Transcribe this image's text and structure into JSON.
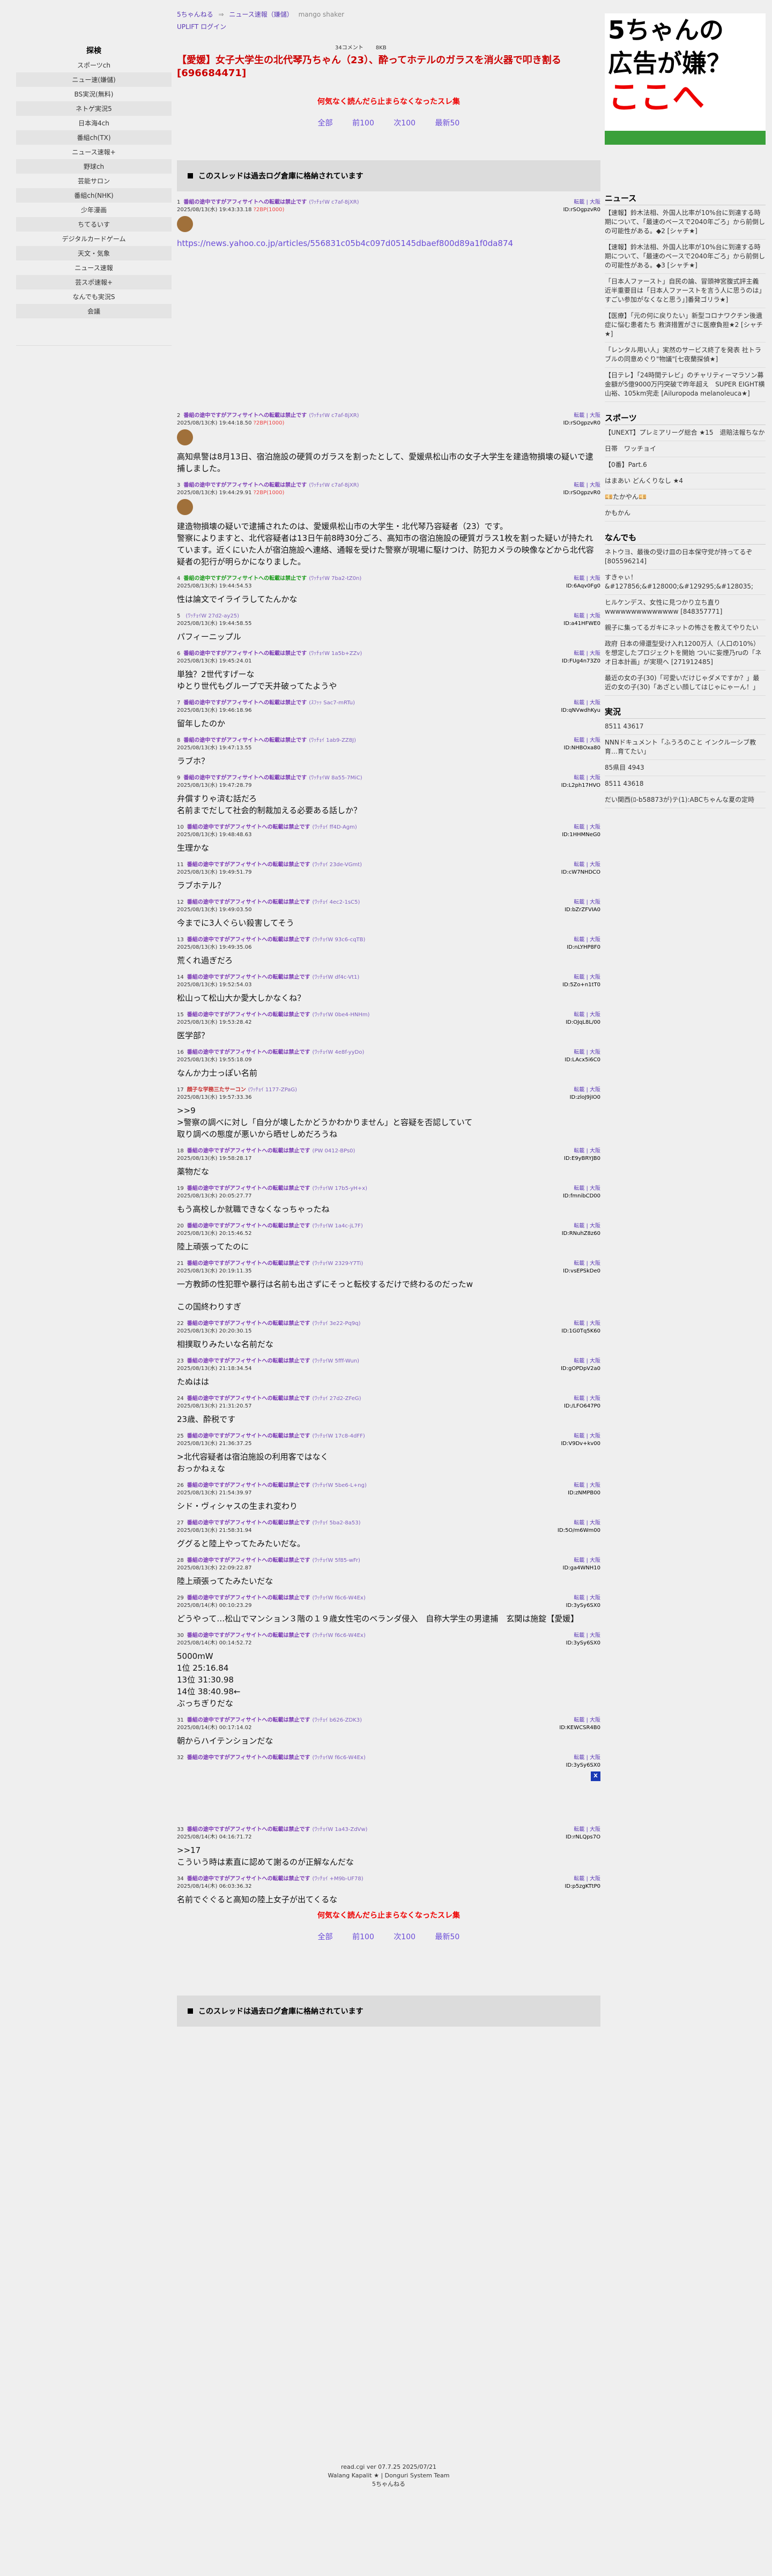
{
  "left": {
    "head": "探検",
    "items": [
      "スポーツch",
      "ニュー速(嫌儲)",
      "BS実況(無料)",
      "ネトゲ実況5",
      "日本海4ch",
      "番組ch(TX)",
      "ニュース速報+",
      "野球ch",
      "芸能サロン",
      "番組ch(NHK)",
      "少年漫画",
      "ちてるいす",
      "デジタルカードゲーム",
      "天文・気象",
      "ニュース速報",
      "芸スポ速報+",
      "なんでも実況S",
      "会議"
    ]
  },
  "nav": {
    "site": "5ちゃんねる",
    "arrow": "⇒",
    "board": "ニュース速報（嫌儲）",
    "mgm": "mango shaker",
    "login": "UPLIFT ログイン",
    "c1": "34コメント",
    "c2": "8KB"
  },
  "title": "【愛媛】女子大学生の北代琴乃ちゃん（23）、酔ってホテルのガラスを消火器で叩き割る[696684471]",
  "warn": "何気なく読んだら止まらなくなったスレ集",
  "pager": {
    "all": "全部",
    "prev": "前100",
    "next": "次100",
    "last": "最新50"
  },
  "archive": "このスレッドは過去ログ倉庫に格納されています",
  "posts": [
    {
      "n": "1",
      "nm": "番組の途中ですがアフィサイトへの転載は禁止です",
      "trip": "(ﾜｯﾁｮｲW c7af-8jXR)",
      "date": "2025/08/13(水) 19:43:33.18",
      "extra": "?2BP(1000)",
      "ref": "転載 | 大阪",
      "id": "ID:rSOgpzvR0",
      "body": [
        "https://news.yahoo.co.jp/articles/556831c05b4c097d05145dbaef800d89a1f0da874"
      ],
      "be": true,
      "link": true,
      "pad": "big"
    },
    {
      "n": "2",
      "nm": "番組の途中ですがアフィサイトへの転載は禁止です",
      "trip": "(ﾜｯﾁｮｲW c7af-8jXR)",
      "date": "2025/08/13(水) 19:44:18.50",
      "extra": "?2BP(1000)",
      "ref": "転載 | 大阪",
      "id": "ID:rSOgpzvR0",
      "body": [
        "高知県警は8月13日、宿泊施設の硬質のガラスを割ったとして、愛媛県松山市の女子大学生を建造物損壊の疑いで逮捕しました。"
      ],
      "be": true
    },
    {
      "n": "3",
      "nm": "番組の途中ですがアフィサイトへの転載は禁止です",
      "trip": "(ﾜｯﾁｮｲW c7af-8jXR)",
      "date": "2025/08/13(水) 19:44:29.91",
      "extra": "?2BP(1000)",
      "ref": "転載 | 大阪",
      "id": "ID:rSOgpzvR0",
      "body": [
        "建造物損壊の疑いで逮捕されたのは、愛媛県松山市の大学生・北代琴乃容疑者（23）です。",
        "警察によりますと、北代容疑者は13日午前8時30分ごろ、高知市の宿泊施設の硬質ガラス1枚を割った疑いが持たれています。近くにいた人が宿泊施設へ連絡、通報を受けた警察が現場に駆けつけ、防犯カメラの映像などから北代容疑者の犯行が明らかになりました。"
      ],
      "be": true
    },
    {
      "n": "4",
      "nm": "番組の途中ですがアフィサイトへの転載は禁止です",
      "trip": "(ﾜｯﾁｮｲW 7ba2-tZ0n)",
      "date": "2025/08/13(水) 19:44:54.53",
      "ref": "転載 | 大阪",
      "id": "ID:6Aqv0Fg0",
      "body": [
        "性は論文でイライラしてたんかな"
      ],
      "c": "g"
    },
    {
      "n": "5",
      "nm": "",
      "trip": "(ﾜｯﾁｮｲW 27d2-ay25)",
      "date": "2025/08/13(水) 19:44:58.55",
      "ref": "転載 | 大阪",
      "id": "ID:a41HFWE0",
      "body": [
        "パフィーニップル"
      ]
    },
    {
      "n": "6",
      "nm": "番組の途中ですがアフィサイトへの転載は禁止です",
      "trip": "(ﾜｯﾁｮｲW 1a5b+ZZv)",
      "date": "2025/08/13(水) 19:45:24.01",
      "ref": "転載 | 大阪",
      "id": "ID:FUg4n73Z0",
      "body": [
        "単独？2世代すげーな",
        "ゆとり世代もグループで天井破ってたようや"
      ]
    },
    {
      "n": "7",
      "nm": "番組の途中ですがアフィサイトへの転載は禁止です",
      "trip": "(ｽﾌｯｯ Sac7-mRTu)",
      "date": "2025/08/13(水) 19:46:18.96",
      "ref": "転載 | 大阪",
      "id": "ID:qNVwdhKyu",
      "body": [
        "留年したのか"
      ]
    },
    {
      "n": "8",
      "nm": "番組の途中ですがアフィサイトへの転載は禁止です",
      "trip": "(ﾜｯﾁｮｲ 1ab9-ZZ8J)",
      "date": "2025/08/13(水) 19:47:13.55",
      "ref": "転載 | 大阪",
      "id": "ID:NHBOxa80",
      "body": [
        "ラブホ？"
      ]
    },
    {
      "n": "9",
      "nm": "番組の途中ですがアフィサイトへの転載は禁止です",
      "trip": "(ﾜｯﾁｮｲW 8a55-7MiC)",
      "date": "2025/08/13(水) 19:47:28.79",
      "ref": "転載 | 大阪",
      "id": "ID:L2ph17HVO",
      "body": [
        "弁償すりゃ済む話だろ",
        "名前までだして社会的制裁加える必要ある話しか？"
      ]
    },
    {
      "n": "10",
      "nm": "番組の途中ですがアフィサイトへの転載は禁止です",
      "trip": "(ﾜｯﾁｮｲ ff4D-Agm)",
      "date": "2025/08/13(水) 19:48:48.63",
      "ref": "転載 | 大阪",
      "id": "ID:1HHMNeG0",
      "body": [
        "生理かな"
      ]
    },
    {
      "n": "11",
      "nm": "番組の途中ですがアフィサイトへの転載は禁止です",
      "trip": "(ﾜｯﾁｮｲ 23de-VGmt)",
      "date": "2025/08/13(水) 19:49:51.79",
      "ref": "転載 | 大阪",
      "id": "ID:cW7NHDCO",
      "body": [
        "ラブホテル？"
      ]
    },
    {
      "n": "12",
      "nm": "番組の途中ですがアフィサイトへの転載は禁止です",
      "trip": "(ﾜｯﾁｮｲ 4ec2-1sC5)",
      "date": "2025/08/13(水) 19:49:03.50",
      "ref": "転載 | 大阪",
      "id": "ID:bZrZFVIA0",
      "body": [
        "今までに3人ぐらい殺害してそう"
      ]
    },
    {
      "n": "13",
      "nm": "番組の途中ですがアフィサイトへの転載は禁止です",
      "trip": "(ﾜｯﾁｮｲW 93c6-cqTB)",
      "date": "2025/08/13(水) 19:49:35.06",
      "ref": "転載 | 大阪",
      "id": "ID:nLYHP8F0",
      "body": [
        "荒くれ過ぎだろ"
      ]
    },
    {
      "n": "14",
      "nm": "番組の途中ですがアフィサイトへの転載は禁止です",
      "trip": "(ﾜｯﾁｮｲW df4c-Vt1)",
      "date": "2025/08/13(水) 19:52:54.03",
      "ref": "転載 | 大阪",
      "id": "ID:5Zo+n1tT0",
      "body": [
        "松山って松山大か愛大しかなくね？"
      ]
    },
    {
      "n": "15",
      "nm": "番組の途中ですがアフィサイトへの転載は禁止です",
      "trip": "(ﾜｯﾁｮｲW 0be4-HNHm)",
      "date": "2025/08/13(水) 19:53:28.42",
      "ref": "転載 | 大阪",
      "id": "ID:OJqL8L/00",
      "body": [
        "医学部？"
      ]
    },
    {
      "n": "16",
      "nm": "番組の途中ですがアフィサイトへの転載は禁止です",
      "trip": "(ﾜｯﾁｮｲW 4e8f-yyDo)",
      "date": "2025/08/13(水) 19:55:18.09",
      "ref": "転載 | 大阪",
      "id": "ID:LAcx5i6C0",
      "body": [
        "なんか力士っぽい名前"
      ]
    },
    {
      "n": "17",
      "nm": "顔子な学務三たサーコン",
      "trip": "(ﾜｯﾁｮｲ 1177-ZPaG)",
      "date": "2025/08/13(水) 19:57:33.36",
      "ref": "転載 | 大阪",
      "id": "ID:zloJ9jIO0",
      "body": [
        ">>9",
        ">警察の調べに対し「自分が壊したかどうかわかりません」と容疑を否認していて",
        "取り調べの態度が悪いから晒せしめだろうね"
      ],
      "c": "r"
    },
    {
      "n": "18",
      "nm": "番組の途中ですがアフィサイトへの転載は禁止です",
      "trip": "(PW 0412-BPs0)",
      "date": "2025/08/13(水) 19:58:28.17",
      "ref": "転載 | 大阪",
      "id": "ID:E9yBRYJB0",
      "body": [
        "薬物だな"
      ]
    },
    {
      "n": "19",
      "nm": "番組の途中ですがアフィサイトへの転載は禁止です",
      "trip": "(ﾜｯﾁｮｲW 17b5-yH+x)",
      "date": "2025/08/13(水) 20:05:27.77",
      "ref": "転載 | 大阪",
      "id": "ID:fmnibCD00",
      "body": [
        "もう高校しか就職できなくなっちゃったね"
      ]
    },
    {
      "n": "20",
      "nm": "番組の途中ですがアフィサイトへの転載は禁止です",
      "trip": "(ﾜｯﾁｮｲW 1a4c-jL7F)",
      "date": "2025/08/13(水) 20:15:46.52",
      "ref": "転載 | 大阪",
      "id": "ID:RNuhZ8z60",
      "body": [
        "陸上頑張ってたのに"
      ]
    },
    {
      "n": "21",
      "nm": "番組の途中ですがアフィサイトへの転載は禁止です",
      "trip": "(ﾜｯﾁｮｲW 2329-Y7Ti)",
      "date": "2025/08/13(水) 20:19:11.35",
      "ref": "転載 | 大阪",
      "id": "ID:vsEPSkDe0",
      "body": [
        "一方教師の性犯罪や暴行は名前も出さずにそっと転校するだけで終わるのだったw",
        "",
        "この国終わりすぎ"
      ]
    },
    {
      "n": "22",
      "nm": "番組の途中ですがアフィサイトへの転載は禁止です",
      "trip": "(ﾜｯﾁｮｲ 3e22-Pq9q)",
      "date": "2025/08/13(水) 20:20:30.15",
      "ref": "転載 | 大阪",
      "id": "ID:1G0Tq5K60",
      "body": [
        "相撲取りみたいな名前だな"
      ]
    },
    {
      "n": "23",
      "nm": "番組の途中ですがアフィサイトへの転載は禁止です",
      "trip": "(ﾜｯﾁｮｲW 5fff-Wun)",
      "date": "2025/08/13(水) 21:18:34.54",
      "ref": "転載 | 大阪",
      "id": "ID:gOPDpV2a0",
      "body": [
        "たぬはは"
      ]
    },
    {
      "n": "24",
      "nm": "番組の途中ですがアフィサイトへの転載は禁止です",
      "trip": "(ﾜｯﾁｮｲ 27d2-ZFeG)",
      "date": "2025/08/13(水) 21:31:20.57",
      "ref": "転載 | 大阪",
      "id": "ID:/LFO647P0",
      "body": [
        "23歳、酔税です"
      ]
    },
    {
      "n": "25",
      "nm": "番組の途中ですがアフィサイトへの転載は禁止です",
      "trip": "(ﾜｯﾁｮｲW 17c8-4dFF)",
      "date": "2025/08/13(水) 21:36:37.25",
      "ref": "転載 | 大阪",
      "id": "ID:V9Dv+kv00",
      "body": [
        ">北代容疑者は宿泊施設の利用客ではなく",
        "おっかねぇな"
      ]
    },
    {
      "n": "26",
      "nm": "番組の途中ですがアフィサイトへの転載は禁止です",
      "trip": "(ﾜｯﾁｮｲW 5be6-L+ng)",
      "date": "2025/08/13(水) 21:54:39.97",
      "ref": "転載 | 大阪",
      "id": "ID:zNMPB00",
      "body": [
        "シド・ヴィシャスの生まれ変わり"
      ]
    },
    {
      "n": "27",
      "nm": "番組の途中ですがアフィサイトへの転載は禁止です",
      "trip": "(ﾜｯﾁｮｲ 5ba2-8a53)",
      "date": "2025/08/13(水) 21:58:31.94",
      "ref": "転載 | 大阪",
      "id": "ID:5O/m6Wm00",
      "body": [
        "ググると陸上やってたみたいだな。"
      ]
    },
    {
      "n": "28",
      "nm": "番組の途中ですがアフィサイトへの転載は禁止です",
      "trip": "(ﾜｯﾁｮｲW 5f85-wFr)",
      "date": "2025/08/13(水) 22:09:22.87",
      "ref": "転載 | 大阪",
      "id": "ID:ga4WNH10",
      "body": [
        "陸上頑張ってたみたいだな"
      ]
    },
    {
      "n": "29",
      "nm": "番組の途中ですがアフィサイトへの転載は禁止です",
      "trip": "(ﾜｯﾁｮｲW f6c6-W4Ex)",
      "date": "2025/08/14(木) 00:10:23.29",
      "ref": "転載 | 大阪",
      "id": "ID:3ySy6SX0",
      "body": [
        "どうやって…松山でマンション３階の１９歳女性宅のベランダ侵入　自称大学生の男逮捕　玄関は施錠【愛媛】"
      ]
    },
    {
      "n": "30",
      "nm": "番組の途中ですがアフィサイトへの転載は禁止です",
      "trip": "(ﾜｯﾁｮｲW f6c6-W4Ex)",
      "date": "2025/08/14(木) 00:14:52.72",
      "ref": "転載 | 大阪",
      "id": "ID:3ySy6SX0",
      "body": [
        "5000mW",
        "1位 25:16.84",
        "13位 31:30.98",
        "14位 38:40.98←",
        "ぶっちぎりだな"
      ]
    },
    {
      "n": "31",
      "nm": "番組の途中ですがアフィサイトへの転載は禁止です",
      "trip": "(ﾜｯﾁｮｲ b626-ZDK3)",
      "date": "2025/08/14(木) 00:17:14.02",
      "ref": "転載 | 大阪",
      "id": "ID:KEWCSR4B0",
      "body": [
        "朝からハイテンションだな"
      ]
    },
    {
      "n": "32",
      "nm": "番組の途中ですがアフィサイトへの転載は禁止です",
      "trip": "(ﾜｯﾁｮｲW f6c6-W4Ex)",
      "date": "",
      "ref": "転載 | 大阪",
      "id": "ID:3ySy6SX0",
      "body": [
        ""
      ],
      "pad": "mid",
      "x": true
    },
    {
      "n": "33",
      "nm": "番組の途中ですがアフィサイトへの転載は禁止です",
      "trip": "(ﾜｯﾁｮｲW 1a43-ZdVw)",
      "date": "2025/08/14(木) 04:16:71.72",
      "ref": "転載 | 大阪",
      "id": "ID:rNLQps7O",
      "body": [
        ">>17",
        "こういう時は素直に認めて謝るのが正解なんだな"
      ]
    },
    {
      "n": "34",
      "nm": "番組の途中ですがアフィサイトへの転載は禁止です",
      "trip": "(ﾜｯﾁｮｲ +M9b-UF78)",
      "date": "2025/08/14(木) 06:03:36.32",
      "ref": "転載 | 大阪",
      "id": "ID:p5zgKTtP0",
      "body": [
        "名前でぐぐると高知の陸上女子が出てくるな"
      ]
    }
  ],
  "ad": {
    "l1": "5ちゃんの",
    "l2": "広告が嫌？",
    "l3": "ここへ"
  },
  "right": {
    "sections": [
      {
        "head": "ニュース",
        "items": [
          "【速報】鈴木法相、外国人比率が10%台に到達する時期について、「最速のペースで2040年ごろ」から前倒しの可能性がある。◆2 [シャチ★]",
          "【速報】鈴木法相、外国人比率が10%台に到達する時期について、「最速のペースで2040年ごろ」から前倒しの可能性がある。◆3 [シャチ★]",
          "「日本人ファースト」自民の論、冒頭神宮腹式評主義　近半重要目は「日本人ファーストを言う人に思うのは」すごい参加がなくなと思う」]番発ゴリラ★]",
          "【医療】「元の何に戻りたい」新型コロナワクチン後遺症に悩む患者たち 救済措置がさに医療負担★2 [シャチ★]",
          "「レンタル用い人」実然のサービス終了を発表 社トラブルの同意めぐり\"物議\"[七夜蘭探偵★]",
          "【日テレ】「24時間テレビ」のチャリティーマラソン募金額が5億9000万円突破で昨年超え　SUPER EIGHT横山裕、105km完走 [Ailuropoda melanoleuca★]"
        ]
      },
      {
        "head": "スポーツ",
        "items": [
          "【UNEXT】プレミアリーグ総合 ★15　退賠法報ちなか",
          "日帯　ワッチョイ",
          "【0番】Part.6",
          "はまあい どんくりなし ★4",
          "💴たかやん💴",
          "かもかん"
        ]
      },
      {
        "head": "なんでも",
        "items": [
          "ネトウヨ、最後の受け皿の日本保守党が持ってるぞ [805596214]",
          "すきゃぃ！ &#127856;&#128000;&#129295;&#128035;",
          "ヒルケンデス、女性に見つかり立ち直り wwwwwwwwwwwwww [848357771]",
          "親子に集ってるガキにネットの怖さを教えてやりたい",
          "政府 日本の帰還型受け入れ1200万人（人口の10%）を想定したプロジェクトを開始 ついに妄煙乃ruの「ネオ日本計画」が実現へ [271912485]",
          "最近の女の子(30)「可愛いだけじゃダメですか？」最近の女の子(30)「あざとい顔してはじゃにゃーん！」"
        ]
      },
      {
        "head": "実況",
        "items": [
          "8511 43617",
          "NNNドキュメント「ふうろのこと インクルーシブ教育…育てたい」",
          "85県目 4943",
          "8511 43618",
          "だい関西(ﾛ-b58873が)テ(1):ABCちゃんな夏の定時"
        ]
      }
    ]
  },
  "footer": {
    "l1": "read.cgi ver 07.7.25 2025/07/21",
    "l2": "Walang Kapalit ★ | Donguri System Team",
    "l3": "5ちゃんねる"
  }
}
